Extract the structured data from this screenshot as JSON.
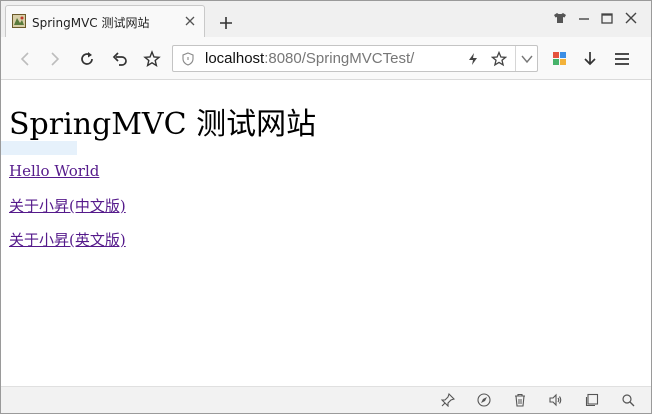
{
  "tab": {
    "title": "SpringMVC 测试网站"
  },
  "addressbar": {
    "host": "localhost",
    "path": ":8080/SpringMVCTest/"
  },
  "page": {
    "heading": "SpringMVC 测试网站",
    "links": [
      "Hello World",
      "关于小昇(中文版)",
      "关于小昇(英文版)"
    ]
  },
  "colors": {
    "visited_link": "#551a8b",
    "chrome_bg": "#f0f0f0"
  },
  "icons": {
    "toolbar": [
      "back-icon",
      "forward-icon",
      "reload-icon",
      "undo-icon",
      "bookmark-star-icon"
    ],
    "right": [
      "extensions-icon",
      "download-icon",
      "menu-icon"
    ],
    "bottom": [
      "pin-icon",
      "compass-icon",
      "trash-icon",
      "speaker-icon",
      "window-icon",
      "search-icon"
    ]
  }
}
